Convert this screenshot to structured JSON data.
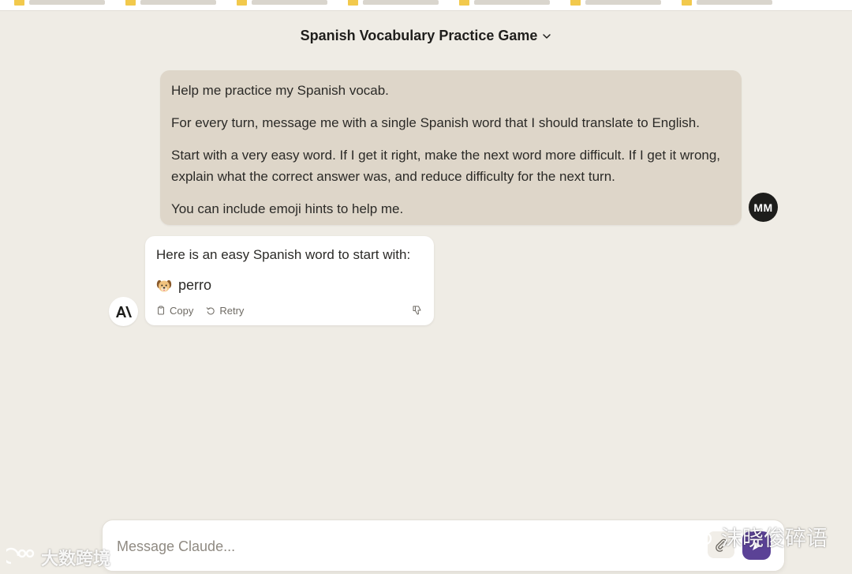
{
  "header": {
    "title": "Spanish Vocabulary Practice Game"
  },
  "user_message": {
    "avatar_initials": "MM",
    "paragraphs": [
      "Help me practice my Spanish vocab.",
      "For every turn, message me with a single Spanish word that I should translate to English.",
      "Start with a very easy word. If I get it right, make the next word more difficult. If I get it wrong, explain what the correct answer was, and reduce difficulty for the next turn.",
      "You can include emoji hints to help me."
    ]
  },
  "assistant_message": {
    "intro": "Here is an easy Spanish word to start with:",
    "emoji_icon": "dog-face-icon",
    "word": "perro",
    "actions": {
      "copy_label": "Copy",
      "retry_label": "Retry"
    }
  },
  "composer": {
    "placeholder": "Message Claude...",
    "value": ""
  },
  "watermarks": {
    "left_text": "大数跨境",
    "right_text": "沫晓俊碎语"
  },
  "colors": {
    "background": "#efece5",
    "user_bubble": "#ded6c9",
    "assistant_bubble": "#ffffff",
    "send_button": "#5b4296",
    "bookmark_folder": "#f2c94c"
  }
}
